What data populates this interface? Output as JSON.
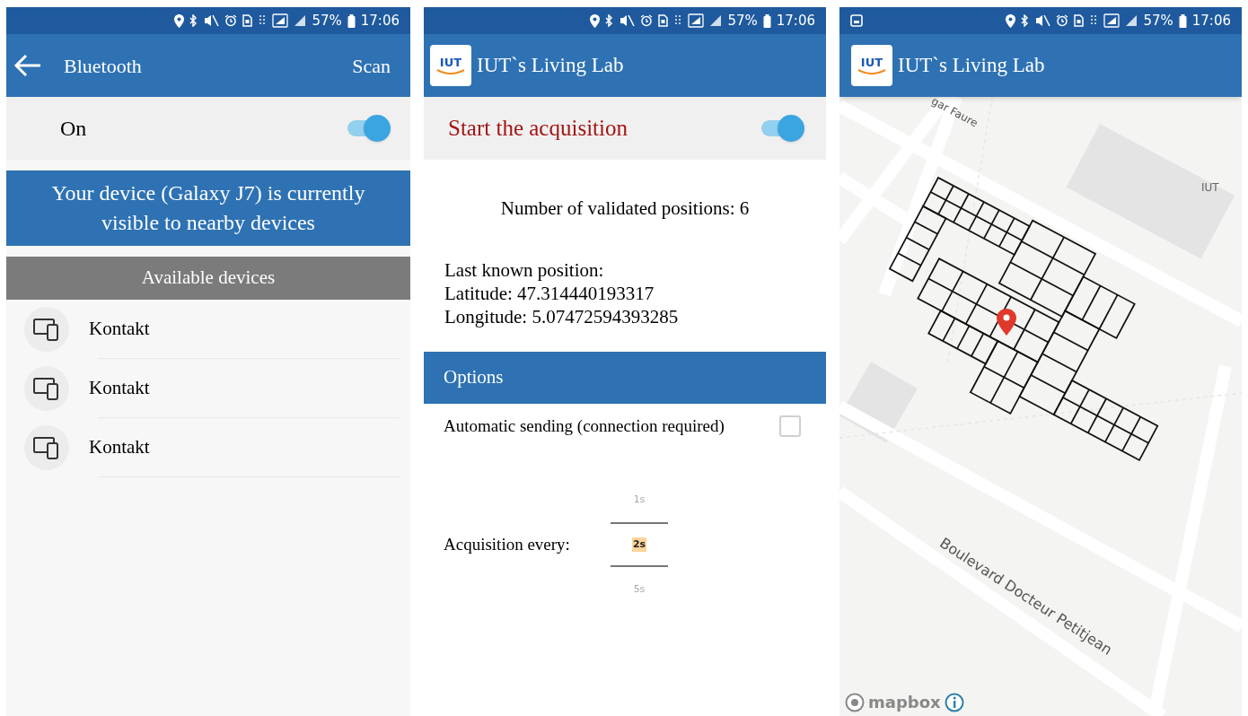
{
  "bluetooth_screen": {
    "status_bar": {
      "battery": "57%",
      "time": "17:06"
    },
    "app_bar": {
      "title": "Bluetooth",
      "action": "Scan"
    },
    "toggle": {
      "label": "On",
      "on": true
    },
    "banner": "Your device (Galaxy J7) is currently visible to nearby devices",
    "section_header": "Available devices",
    "devices": [
      {
        "name": "Kontakt"
      },
      {
        "name": "Kontakt"
      },
      {
        "name": "Kontakt"
      }
    ]
  },
  "acquisition_screen": {
    "status_bar": {
      "battery": "57%",
      "time": "17:06"
    },
    "app_bar": {
      "logo_text": "IUT",
      "title": "IUT`s Living Lab"
    },
    "toggle": {
      "label": "Start the acquisition",
      "on": true
    },
    "validated_positions": "Number of validated positions: 6",
    "last_position": [
      "Last known position:",
      "Latitude: 47.314440193317",
      "Longitude: 5.07472594393285"
    ],
    "options_header": "Options",
    "automatic_sending": {
      "label": "Automatic sending (connection required)",
      "checked": false
    },
    "acquisition_interval": {
      "label": "Acquisition every:",
      "options": [
        {
          "label": "1s",
          "selected": false
        },
        {
          "label": "2s",
          "selected": true
        },
        {
          "label": "5s",
          "selected": false
        }
      ]
    }
  },
  "map_screen": {
    "status_bar": {
      "battery": "57%",
      "time": "17:06"
    },
    "app_bar": {
      "logo_text": "IUT",
      "title": "IUT`s Living Lab"
    },
    "map_labels": [
      "gar Faure",
      "IUT",
      "Boulevard Docteur Petitjean"
    ],
    "attribution": "mapbox"
  }
}
